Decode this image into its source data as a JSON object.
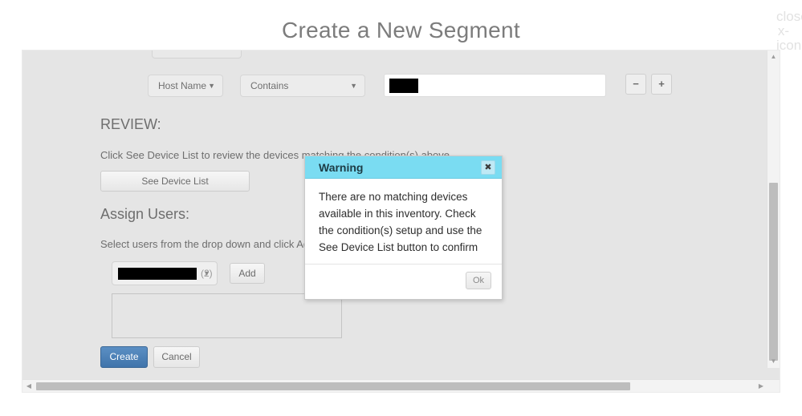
{
  "modal": {
    "title": "Create a New Segment",
    "close_icon": "close-x-icon"
  },
  "condition_row": {
    "attribute_select": {
      "value": "Host Name",
      "caret_icon": "chevron-down-icon"
    },
    "operator_select": {
      "value": "Contains",
      "caret_icon": "chevron-down-icon"
    },
    "value_input": {
      "value": "",
      "placeholder": "",
      "redacted": true
    },
    "remove_button": "−",
    "add_button": "+"
  },
  "review": {
    "heading": "REVIEW:",
    "description": "Click See Device List to review the devices matching the condition(s) above.",
    "see_device_list_button": "See Device List"
  },
  "assign_users": {
    "heading": "Assign Users:",
    "description": "Select users from the drop down and click Add.",
    "user_dropdown": {
      "value": "",
      "count": "(2)",
      "caret_icon": "chevron-down-icon",
      "redacted": true
    },
    "add_button": "Add",
    "assigned_list": []
  },
  "footer": {
    "create_button": "Create",
    "cancel_button": "Cancel"
  },
  "scrollbars": {
    "vertical": {
      "up_arrow_icon": "triangle-up-icon",
      "down_arrow_icon": "triangle-down-icon"
    },
    "horizontal": {
      "left_arrow_icon": "triangle-left-icon",
      "right_arrow_icon": "triangle-right-icon"
    }
  },
  "warning_dialog": {
    "title": "Warning",
    "close_icon": "close-x-icon",
    "message": "There are no matching devices available in this inventory. Check the condition(s) setup and use the See Device List button to confirm",
    "ok_button": "Ok"
  },
  "colors": {
    "dialog_header": "#7adcf2",
    "create_button": "#4a7fb4",
    "panel_background": "#e5e5e5",
    "title_text": "#7c7c7c"
  }
}
